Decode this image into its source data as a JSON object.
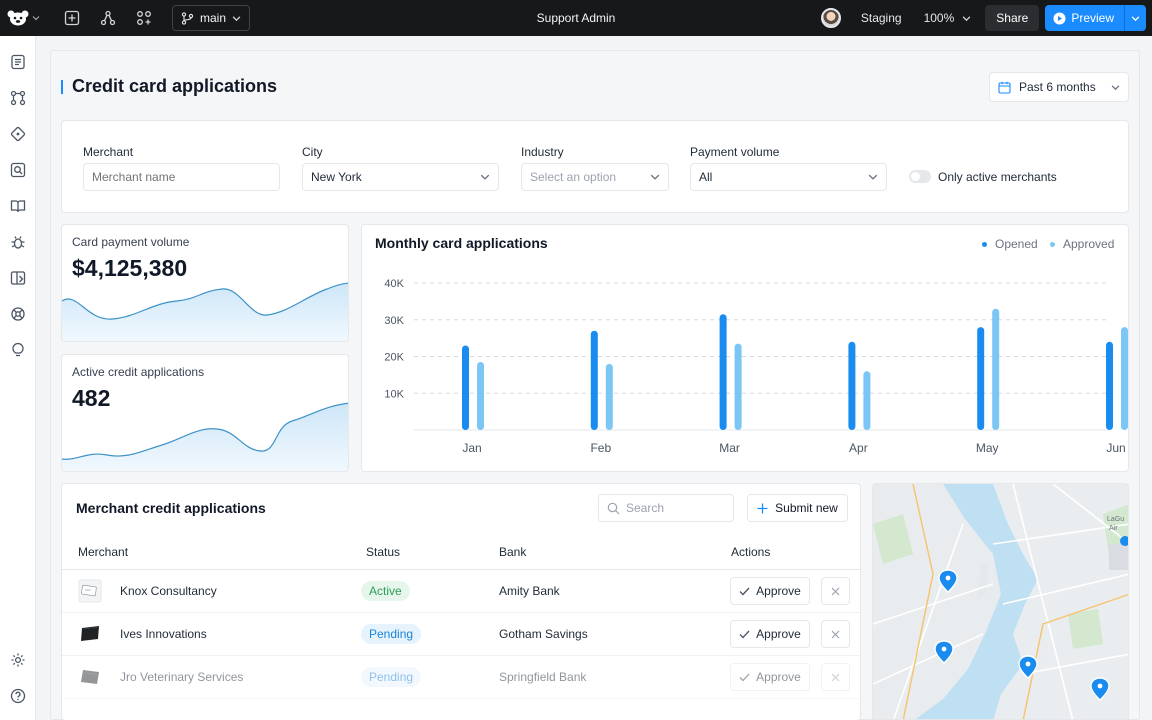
{
  "topbar": {
    "branch": "main",
    "title": "Support Admin",
    "environment": "Staging",
    "zoom": "100%",
    "share_label": "Share",
    "preview_label": "Preview"
  },
  "sidebar": {
    "items": [
      "pages-icon",
      "components-icon",
      "git-icon",
      "search-data-icon",
      "docs-icon",
      "debug-icon",
      "library-icon",
      "integrations-icon",
      "ideas-icon"
    ],
    "bottom": [
      "settings-icon",
      "help-icon"
    ]
  },
  "page": {
    "title": "Credit card applications",
    "date_range": "Past 6 months"
  },
  "filters": {
    "merchant": {
      "label": "Merchant",
      "placeholder": "Merchant name"
    },
    "city": {
      "label": "City",
      "value": "New York"
    },
    "industry": {
      "label": "Industry",
      "placeholder": "Select an option"
    },
    "payment_volume": {
      "label": "Payment volume",
      "value": "All"
    },
    "toggle": {
      "label": "Only active merchants",
      "on": false
    }
  },
  "stats": [
    {
      "label": "Card payment volume",
      "value": "$4,125,380"
    },
    {
      "label": "Active credit applications",
      "value": "482"
    }
  ],
  "chart_data": {
    "type": "bar",
    "title": "Monthly card applications",
    "categories": [
      "Jan",
      "Feb",
      "Mar",
      "Apr",
      "May",
      "Jun"
    ],
    "series": [
      {
        "name": "Opened",
        "color": "#1a8cf0",
        "values": [
          23000,
          27000,
          31500,
          24000,
          28000,
          24000
        ]
      },
      {
        "name": "Approved",
        "color": "#7cc6f5",
        "values": [
          18500,
          18000,
          23500,
          16000,
          33000,
          28000
        ]
      }
    ],
    "yticks": [
      "10K",
      "20K",
      "30K",
      "40K"
    ],
    "ylim": [
      0,
      40000
    ],
    "grid": true,
    "legend": "top-right"
  },
  "table": {
    "title": "Merchant credit applications",
    "search_placeholder": "Search",
    "submit_label": "Submit new",
    "columns": [
      "Merchant",
      "Status",
      "Bank",
      "Actions"
    ],
    "approve_label": "Approve",
    "rows": [
      {
        "merchant": "Knox Consultancy",
        "status": "Active",
        "status_kind": "active",
        "bank": "Amity Bank"
      },
      {
        "merchant": "Ives Innovations",
        "status": "Pending",
        "status_kind": "pending",
        "bank": "Gotham Savings"
      },
      {
        "merchant": "Jro Veterinary Services",
        "status": "Pending",
        "status_kind": "pending",
        "bank": "Springfield Bank"
      }
    ]
  },
  "map": {
    "markers": 4,
    "labels": [
      "LaGu",
      "Air"
    ]
  }
}
